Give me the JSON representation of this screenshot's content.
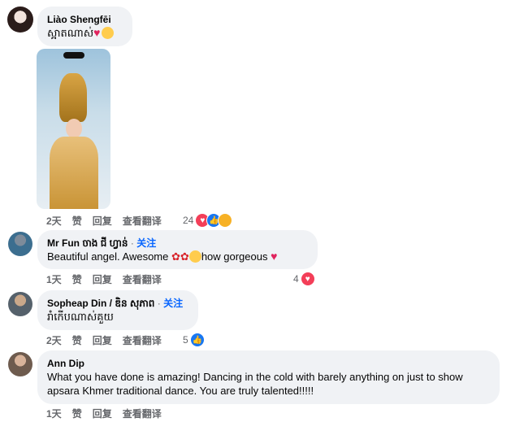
{
  "comments": [
    {
      "author": "Liào Shengfēi",
      "text": "ស្អាតណាស់",
      "time": "2天",
      "like": "赞",
      "reply": "回复",
      "translate": "查看翻译",
      "reaction_count": "24"
    },
    {
      "author": "Mr Fun ចាង ជី ហ្វាន់",
      "follow": "关注",
      "text_a": "Beautiful angel. Awesome",
      "text_b": "how gorgeous",
      "time": "1天",
      "like": "赞",
      "reply": "回复",
      "translate": "查看翻译",
      "reaction_count": "4"
    },
    {
      "author": "Sopheap Din / ឌិន សុភាព",
      "follow": "关注",
      "text": "រាំកើបណាស់គួយ",
      "time": "2天",
      "like": "赞",
      "reply": "回复",
      "translate": "查看翻译",
      "reaction_count": "5"
    },
    {
      "author": "Ann Dip",
      "text": "What you have done is amazing! Dancing in the cold with barely anything on just to show apsara Khmer traditional dance. You are truly talented!!!!!",
      "time": "1天",
      "like": "赞",
      "reply": "回复",
      "translate": "查看翻译"
    }
  ],
  "colors": {
    "bubble": "#f0f2f5",
    "link": "#0866ff",
    "heart": "#f33e58",
    "like": "#1877f2",
    "meta": "#65676b"
  },
  "icons": [
    "heart-reaction-icon",
    "like-reaction-icon",
    "care-reaction-icon",
    "rose-emoji-icon",
    "heart-eyes-emoji-icon",
    "kiss-emoji-icon"
  ]
}
